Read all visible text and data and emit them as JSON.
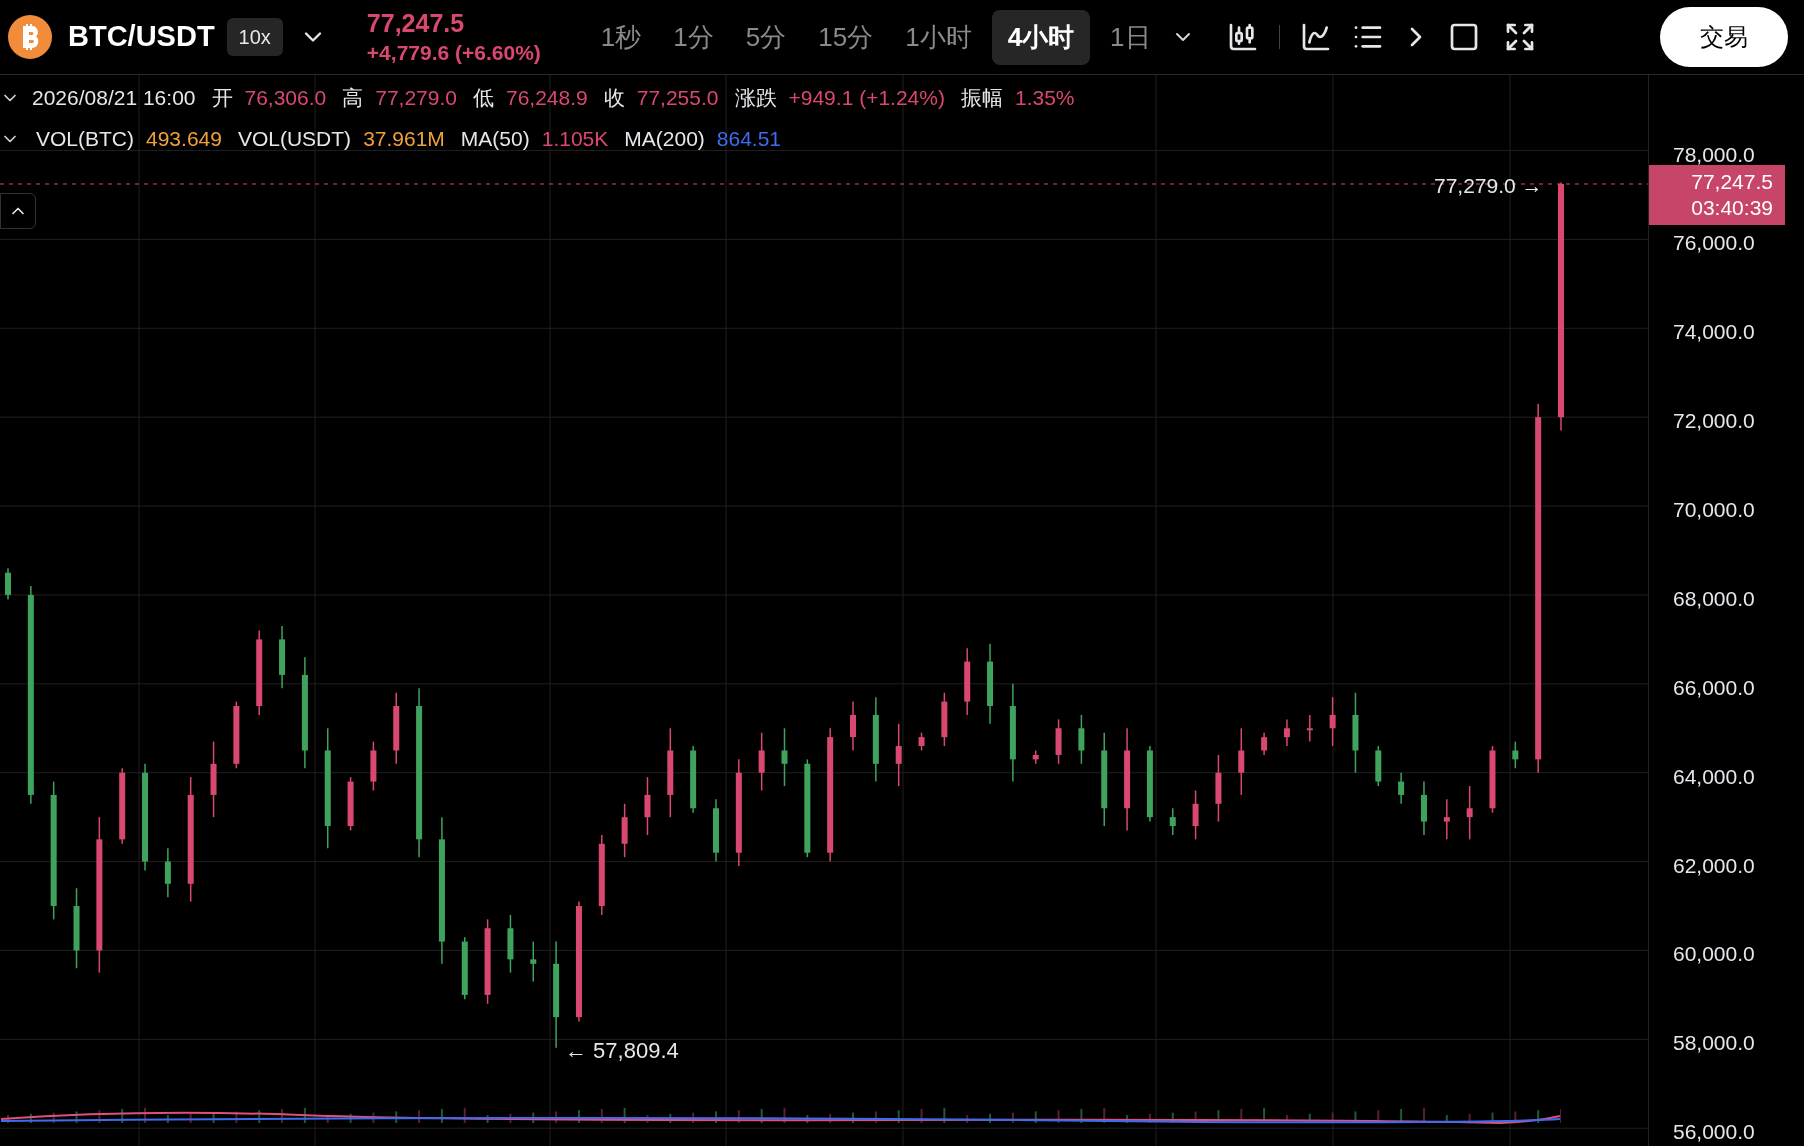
{
  "header": {
    "symbol": "BTC/USDT",
    "leverage": "10x",
    "price": "77,247.5",
    "change": "+4,779.6 (+6.60%)"
  },
  "timeframes": [
    {
      "label": "1秒",
      "selected": false
    },
    {
      "label": "1分",
      "selected": false
    },
    {
      "label": "5分",
      "selected": false
    },
    {
      "label": "15分",
      "selected": false
    },
    {
      "label": "1小时",
      "selected": false
    },
    {
      "label": "4小时",
      "selected": true
    },
    {
      "label": "1日",
      "selected": false
    }
  ],
  "trade_button": "交易",
  "ohlc_row": {
    "date": "2026/08/21 16:00",
    "items": [
      {
        "label": "开",
        "value": "76,306.0",
        "color": "#d9486e"
      },
      {
        "label": "高",
        "value": "77,279.0",
        "color": "#d9486e"
      },
      {
        "label": "低",
        "value": "76,248.9",
        "color": "#d9486e"
      },
      {
        "label": "收",
        "value": "77,255.0",
        "color": "#d9486e"
      },
      {
        "label": "涨跌",
        "value": "+949.1 (+1.24%)",
        "color": "#d9486e"
      },
      {
        "label": "振幅",
        "value": "1.35%",
        "color": "#d9486e"
      }
    ]
  },
  "volume_row": {
    "items": [
      {
        "label": "VOL(BTC)",
        "value": "493.649",
        "color": "#f0a23a"
      },
      {
        "label": "VOL(USDT)",
        "value": "37.961M",
        "color": "#f0a23a"
      },
      {
        "label": "MA(50)",
        "value": "1.105K",
        "color": "#d9486e"
      },
      {
        "label": "MA(200)",
        "value": "864.51",
        "color": "#3d6cf0"
      }
    ]
  },
  "chart": {
    "high_label": "77,279.0 →",
    "low_label": "← 57,809.4",
    "price_tag": "77,247.5",
    "countdown": "03:40:39",
    "chart_data": {
      "type": "candlestick",
      "ylim": [
        55600,
        79700
      ],
      "grid": true,
      "ref_lines": [
        {
          "axis": "y",
          "value": 77247.5
        }
      ],
      "yticks": [
        {
          "value": 78000,
          "label": "78,000.0"
        },
        {
          "value": 76000,
          "label": "76,000.0"
        },
        {
          "value": 74000,
          "label": "74,000.0"
        },
        {
          "value": 72000,
          "label": "72,000.0"
        },
        {
          "value": 70000,
          "label": "70,000.0"
        },
        {
          "value": 68000,
          "label": "68,000.0"
        },
        {
          "value": 66000,
          "label": "66,000.0"
        },
        {
          "value": 64000,
          "label": "64,000.0"
        },
        {
          "value": 62000,
          "label": "62,000.0"
        },
        {
          "value": 60000,
          "label": "60,000.0"
        },
        {
          "value": 58000,
          "label": "58,000.0"
        },
        {
          "value": 56000,
          "label": "56,000.0"
        }
      ],
      "ohlc": [
        [
          68500,
          68600,
          67900,
          68000
        ],
        [
          68000,
          68200,
          63300,
          63500
        ],
        [
          63500,
          63800,
          60700,
          61000
        ],
        [
          61000,
          61400,
          59600,
          60000
        ],
        [
          60000,
          63000,
          59500,
          62500
        ],
        [
          62500,
          64100,
          62400,
          64000
        ],
        [
          64000,
          64200,
          61800,
          62000
        ],
        [
          62000,
          62300,
          61200,
          61500
        ],
        [
          61500,
          63900,
          61100,
          63500
        ],
        [
          63500,
          64700,
          63000,
          64200
        ],
        [
          64200,
          65600,
          64100,
          65500
        ],
        [
          65500,
          67200,
          65300,
          67000
        ],
        [
          67000,
          67300,
          65900,
          66200
        ],
        [
          66200,
          66600,
          64100,
          64500
        ],
        [
          64500,
          65000,
          62300,
          62800
        ],
        [
          62800,
          63900,
          62700,
          63800
        ],
        [
          63800,
          64700,
          63600,
          64500
        ],
        [
          64500,
          65800,
          64200,
          65500
        ],
        [
          65500,
          65900,
          62100,
          62500
        ],
        [
          62500,
          63000,
          59700,
          60200
        ],
        [
          60200,
          60300,
          58900,
          59000
        ],
        [
          59000,
          60700,
          58800,
          60500
        ],
        [
          60500,
          60800,
          59500,
          59800
        ],
        [
          59800,
          60200,
          59300,
          59700
        ],
        [
          59700,
          60200,
          57809.4,
          58500
        ],
        [
          58500,
          61100,
          58400,
          61000
        ],
        [
          61000,
          62600,
          60800,
          62400
        ],
        [
          62400,
          63300,
          62100,
          63000
        ],
        [
          63000,
          63900,
          62600,
          63500
        ],
        [
          63500,
          65000,
          63000,
          64500
        ],
        [
          64500,
          64600,
          63100,
          63200
        ],
        [
          63200,
          63400,
          62000,
          62200
        ],
        [
          62200,
          64300,
          61900,
          64000
        ],
        [
          64000,
          64900,
          63600,
          64500
        ],
        [
          64500,
          65000,
          63700,
          64200
        ],
        [
          64200,
          64300,
          62100,
          62200
        ],
        [
          62200,
          65000,
          62000,
          64800
        ],
        [
          64800,
          65600,
          64500,
          65300
        ],
        [
          65300,
          65700,
          63800,
          64200
        ],
        [
          64200,
          65100,
          63700,
          64600
        ],
        [
          64600,
          64900,
          64500,
          64800
        ],
        [
          64800,
          65800,
          64600,
          65600
        ],
        [
          65600,
          66800,
          65300,
          66500
        ],
        [
          66500,
          66900,
          65100,
          65500
        ],
        [
          65500,
          66000,
          63800,
          64300
        ],
        [
          64300,
          64500,
          64200,
          64400
        ],
        [
          64400,
          65200,
          64200,
          65000
        ],
        [
          65000,
          65300,
          64200,
          64500
        ],
        [
          64500,
          64900,
          62800,
          63200
        ],
        [
          63200,
          65000,
          62700,
          64500
        ],
        [
          64500,
          64600,
          62900,
          63000
        ],
        [
          63000,
          63200,
          62600,
          62800
        ],
        [
          62800,
          63600,
          62500,
          63300
        ],
        [
          63300,
          64400,
          62900,
          64000
        ],
        [
          64000,
          65000,
          63500,
          64500
        ],
        [
          64500,
          64900,
          64400,
          64800
        ],
        [
          64800,
          65200,
          64600,
          65000
        ],
        [
          65000,
          65300,
          64700,
          65000
        ],
        [
          65000,
          65700,
          64600,
          65300
        ],
        [
          65300,
          65800,
          64000,
          64500
        ],
        [
          64500,
          64600,
          63700,
          63800
        ],
        [
          63800,
          64000,
          63300,
          63500
        ],
        [
          63500,
          63800,
          62600,
          62900
        ],
        [
          62900,
          63400,
          62500,
          63000
        ],
        [
          63000,
          63700,
          62500,
          63200
        ],
        [
          63200,
          64600,
          63100,
          64500
        ],
        [
          64500,
          64700,
          64100,
          64300
        ],
        [
          64300,
          72300,
          64000,
          72000
        ],
        [
          72000,
          77279,
          71700,
          77250
        ]
      ]
    }
  }
}
